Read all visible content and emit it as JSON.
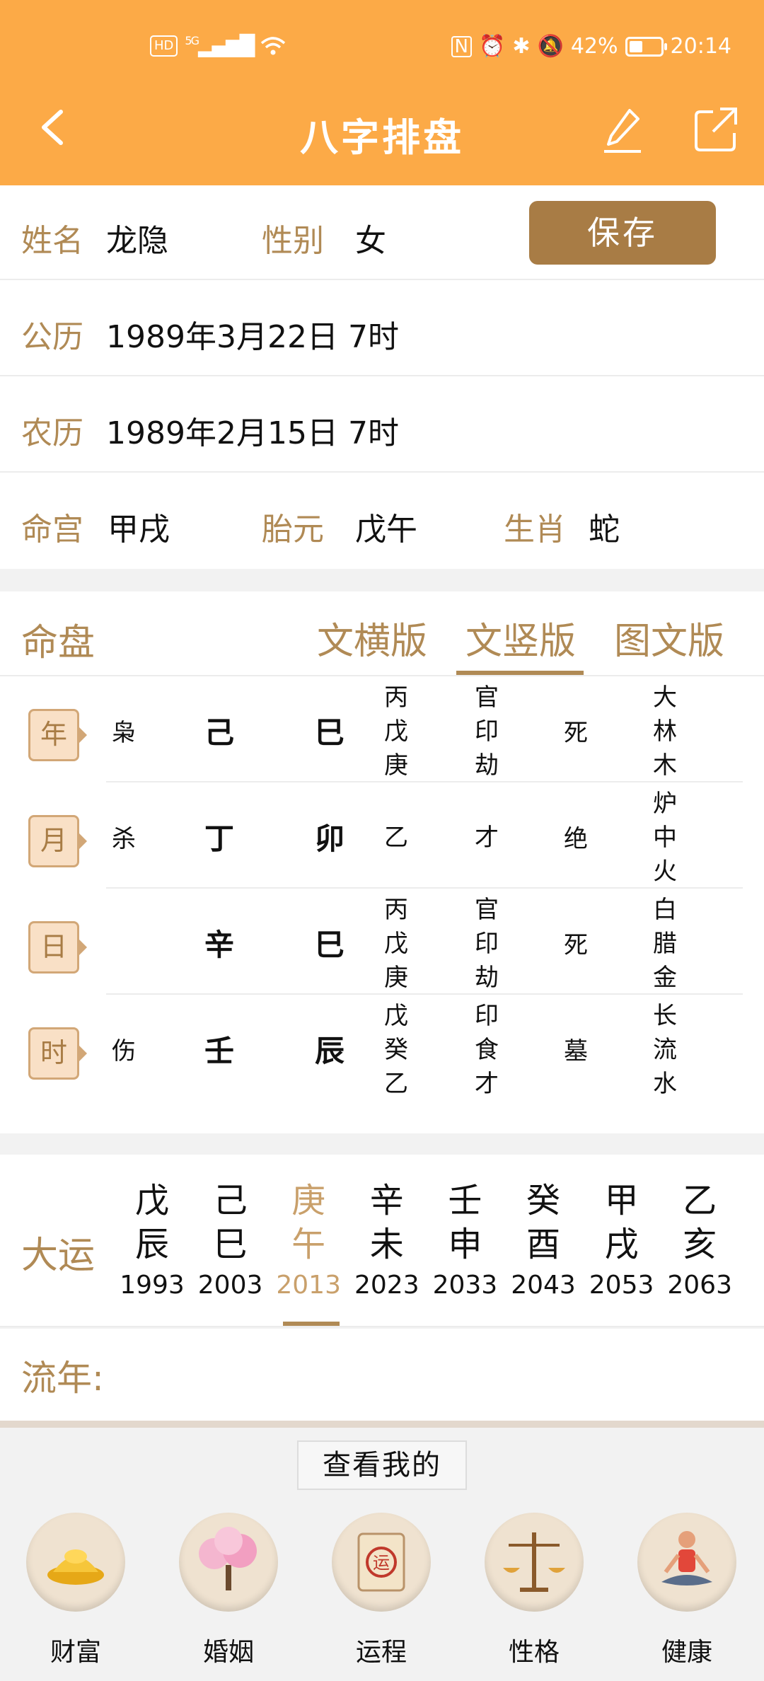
{
  "status_bar": {
    "hd": "HD",
    "signal": "5G",
    "battery_pct": "42%",
    "time": "20:14"
  },
  "header": {
    "title": "八字排盘"
  },
  "info": {
    "name_label": "姓名",
    "name": "龙隐",
    "gender_label": "性别",
    "gender": "女",
    "save_label": "保存",
    "solar_label": "公历",
    "solar": "1989年3月22日 7时",
    "lunar_label": "农历",
    "lunar": "1989年2月15日 7时",
    "minggong_label": "命宫",
    "minggong": "甲戌",
    "taiyuan_label": "胎元",
    "taiyuan": "戊午",
    "zodiac_label": "生肖",
    "zodiac": "蛇"
  },
  "chart": {
    "title": "命盘",
    "tabs": [
      "文横版",
      "文竖版",
      "图文版"
    ],
    "active_tab": "文竖版",
    "pillars": [
      {
        "label": "年",
        "shishen": "枭",
        "gan": "己",
        "zhi": "巳",
        "canggan": [
          "丙",
          "戊",
          "庚"
        ],
        "fuxing": [
          "官",
          "印",
          "劫"
        ],
        "state": "死",
        "nayin": [
          "大",
          "林",
          "木"
        ]
      },
      {
        "label": "月",
        "shishen": "杀",
        "gan": "丁",
        "zhi": "卯",
        "canggan": [
          "乙"
        ],
        "fuxing": [
          "才"
        ],
        "state": "绝",
        "nayin": [
          "炉",
          "中",
          "火"
        ]
      },
      {
        "label": "日",
        "shishen": "",
        "gan": "辛",
        "zhi": "巳",
        "canggan": [
          "丙",
          "戊",
          "庚"
        ],
        "fuxing": [
          "官",
          "印",
          "劫"
        ],
        "state": "死",
        "nayin": [
          "白",
          "腊",
          "金"
        ]
      },
      {
        "label": "时",
        "shishen": "伤",
        "gan": "壬",
        "zhi": "辰",
        "canggan": [
          "戊",
          "癸",
          "乙"
        ],
        "fuxing": [
          "印",
          "食",
          "才"
        ],
        "state": "墓",
        "nayin": [
          "长",
          "流",
          "水"
        ]
      }
    ]
  },
  "dayun": {
    "title": "大运",
    "items": [
      {
        "gan": "戊",
        "zhi": "辰",
        "year": "1993"
      },
      {
        "gan": "己",
        "zhi": "巳",
        "year": "2003"
      },
      {
        "gan": "庚",
        "zhi": "午",
        "year": "2013"
      },
      {
        "gan": "辛",
        "zhi": "未",
        "year": "2023"
      },
      {
        "gan": "壬",
        "zhi": "申",
        "year": "2033"
      },
      {
        "gan": "癸",
        "zhi": "酉",
        "year": "2043"
      },
      {
        "gan": "甲",
        "zhi": "戌",
        "year": "2053"
      },
      {
        "gan": "乙",
        "zhi": "亥",
        "year": "2063"
      }
    ],
    "active_index": 2
  },
  "liunian": {
    "title": "流年:"
  },
  "bottom": {
    "view_my": "查看我的",
    "features": [
      {
        "label": "财富",
        "icon": "gold-ingot-icon"
      },
      {
        "label": "婚姻",
        "icon": "peach-blossom-tree-icon"
      },
      {
        "label": "运程",
        "icon": "fortune-scroll-icon"
      },
      {
        "label": "性格",
        "icon": "balance-scale-icon"
      },
      {
        "label": "健康",
        "icon": "meditation-icon"
      }
    ]
  },
  "colors": {
    "header_bg": "#fcaa47",
    "accent": "#b08a55",
    "save_bg": "#a87c45",
    "badge_bg": "#f9e0c6"
  }
}
